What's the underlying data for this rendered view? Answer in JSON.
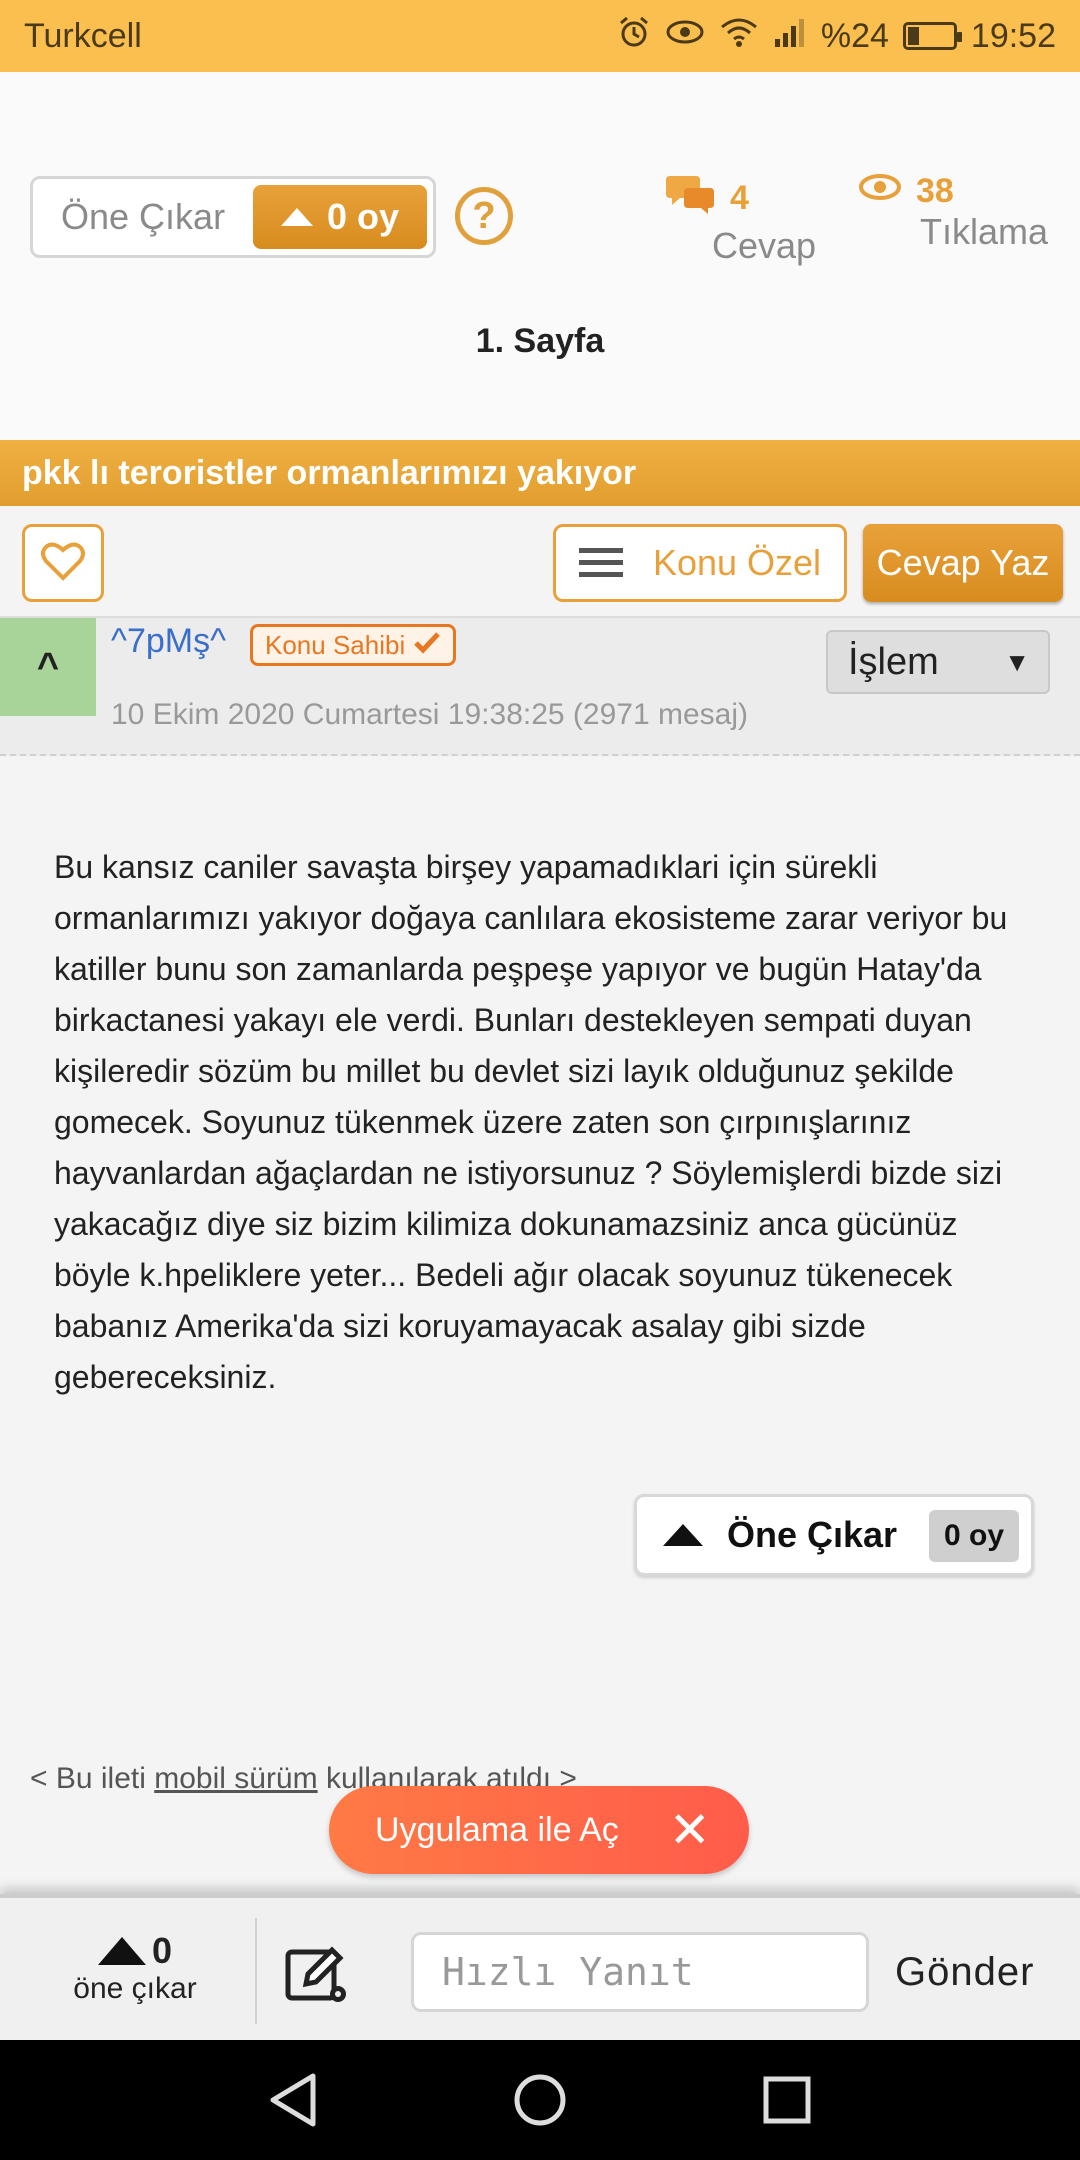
{
  "status_bar": {
    "carrier": "Turkcell",
    "battery": "%24",
    "battery_level": 0.24,
    "time": "19:52"
  },
  "header": {
    "vote_label": "Öne Çıkar",
    "vote_count": "0 oy",
    "help": "?",
    "replies_count": "4",
    "replies_label": "Cevap",
    "views_count": "38",
    "views_label": "Tıklama",
    "page_title": "1. Sayfa"
  },
  "topic": {
    "title": "pkk lı teroristler ormanlarımızı yakıyor",
    "konu_ozel": "Konu Özel",
    "cevap_yaz": "Cevap Yaz"
  },
  "post": {
    "rank": "^",
    "username": "^7pMş^",
    "badge": "Konu Sahibi",
    "action_select": "İşlem",
    "date": "10 Ekim 2020 Cumartesi 19:38:25 (2971 mesaj)",
    "body": "Bu kansız caniler savaşta birşey yapamadıklari için sürekli ormanlarımızı yakıyor doğaya canlılara ekosisteme zarar veriyor bu katiller bunu son zamanlarda peşpeşe yapıyor ve bugün Hatay'da birkactanesi yakayı ele verdi. Bunları destekleyen sempati duyan kişileredir sözüm bu millet bu devlet sizi layık olduğunuz şekilde gomecek. Soyunuz tükenmek üzere zaten son çırpınışlarınız hayvanlardan ağaçlardan ne istiyorsunuz ? Söylemişlerdi bizde sizi yakacağız diye siz bizim kilimiza dokunamazsiniz anca gücünüz böyle k.hpeliklere yeter... Bedeli ağır olacak soyunuz tükenecek babanız Amerika'da sizi koruyamayacak asalay gibi sizde gebereceksiniz.",
    "vote_label": "Öne Çıkar",
    "vote_count": "0 oy",
    "mobile_prefix": "< Bu ileti ",
    "mobile_link": "mobil sürüm",
    "mobile_suffix": " kullanılarak atıldı >"
  },
  "banner": {
    "open_app": "Uygulama ile Aç",
    "close": "✕"
  },
  "reply_bar": {
    "vote_count": "0",
    "vote_label": "öne çıkar",
    "placeholder": "Hızlı Yanıt",
    "send": "Gönder"
  },
  "colors": {
    "accent": "#e8a13a",
    "status_bar": "#fbbf4f",
    "username": "#3a6fc9",
    "badge": "#e87722",
    "open_app": "#ff6a47"
  }
}
